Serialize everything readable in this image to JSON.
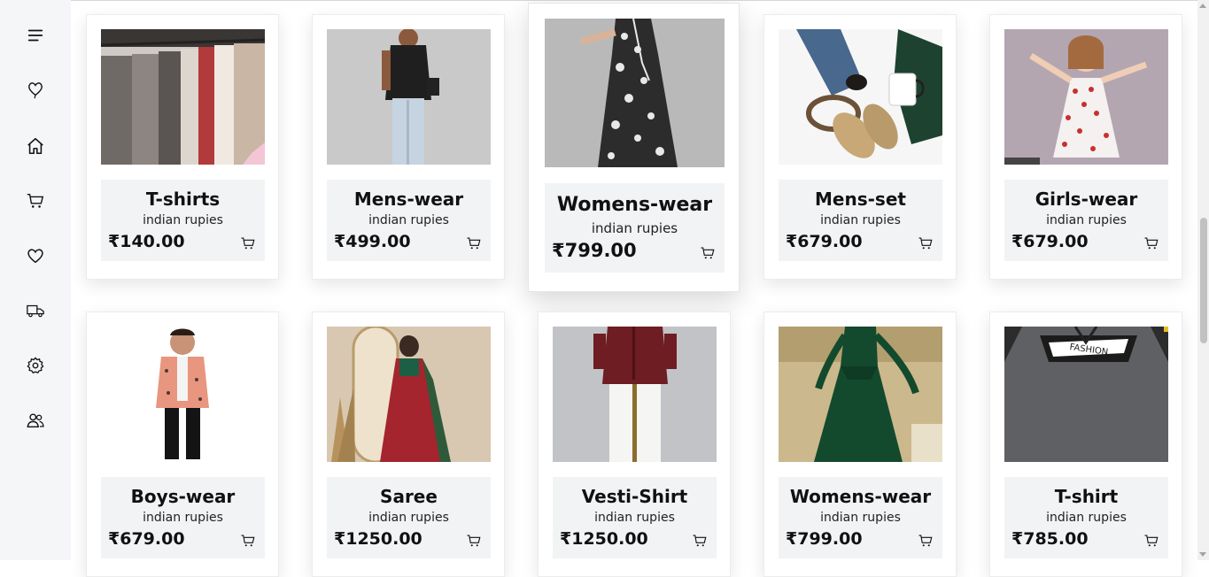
{
  "sidebar": {
    "items": [
      {
        "icon": "menu-icon"
      },
      {
        "icon": "balloon-heart-icon"
      },
      {
        "icon": "home-icon"
      },
      {
        "icon": "cart-icon"
      },
      {
        "icon": "heart-icon"
      },
      {
        "icon": "truck-icon"
      },
      {
        "icon": "settings-icon"
      },
      {
        "icon": "users-icon"
      }
    ]
  },
  "products": [
    {
      "title": "T-shirts",
      "subtitle": "indian rupies",
      "price": "₹140.00",
      "image": "clothes-rack-photo"
    },
    {
      "title": "Mens-wear",
      "subtitle": "indian rupies",
      "price": "₹499.00",
      "image": "man-black-shirt-photo"
    },
    {
      "title": "Womens-wear",
      "subtitle": "indian rupies",
      "price": "₹799.00",
      "image": "floral-dress-photo"
    },
    {
      "title": "Mens-set",
      "subtitle": "indian rupies",
      "price": "₹679.00",
      "image": "jeans-loafers-mug-photo"
    },
    {
      "title": "Girls-wear",
      "subtitle": "indian rupies",
      "price": "₹679.00",
      "image": "girl-floral-dress-photo"
    },
    {
      "title": "Boys-wear",
      "subtitle": "indian rupies",
      "price": "₹679.00",
      "image": "boy-blazer-photo"
    },
    {
      "title": "Saree",
      "subtitle": "indian rupies",
      "price": "₹1250.00",
      "image": "red-saree-mirror-photo"
    },
    {
      "title": "Vesti-Shirt",
      "subtitle": "indian rupies",
      "price": "₹1250.00",
      "image": "maroon-shirt-dhoti-photo"
    },
    {
      "title": "Womens-wear",
      "subtitle": "indian rupies",
      "price": "₹799.00",
      "image": "green-gown-photo"
    },
    {
      "title": "T-shirt",
      "subtitle": "indian rupies",
      "price": "₹785.00",
      "image": "grey-fashion-tshirt-photo"
    }
  ],
  "colors": {
    "sidebar_bg": "#f5f6f8",
    "info_bg": "#f2f3f5",
    "text": "#111111"
  }
}
